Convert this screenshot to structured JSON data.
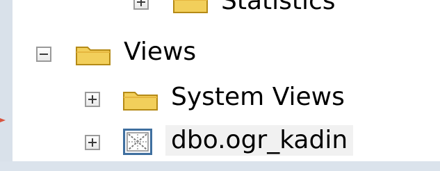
{
  "object_explorer": {
    "nodes": [
      {
        "label": "Statistics",
        "state": "collapsed"
      },
      {
        "label": "Views",
        "state": "expanded"
      },
      {
        "label": "System Views",
        "state": "collapsed"
      },
      {
        "label": "dbo.ogr_kadin",
        "state": "collapsed",
        "selected": true
      }
    ]
  },
  "icons": [
    "plus-expander-icon",
    "minus-expander-icon",
    "folder-icon",
    "view-icon"
  ],
  "colors": {
    "background": "#d9e1ea",
    "panel": "#ffffff",
    "folder_fill": "#f2cf5b",
    "folder_edge": "#b58a16",
    "expander_border": "#9a9a9a",
    "selected_row": "#f1f1f1",
    "view_icon_border": "#3f6f9f"
  }
}
